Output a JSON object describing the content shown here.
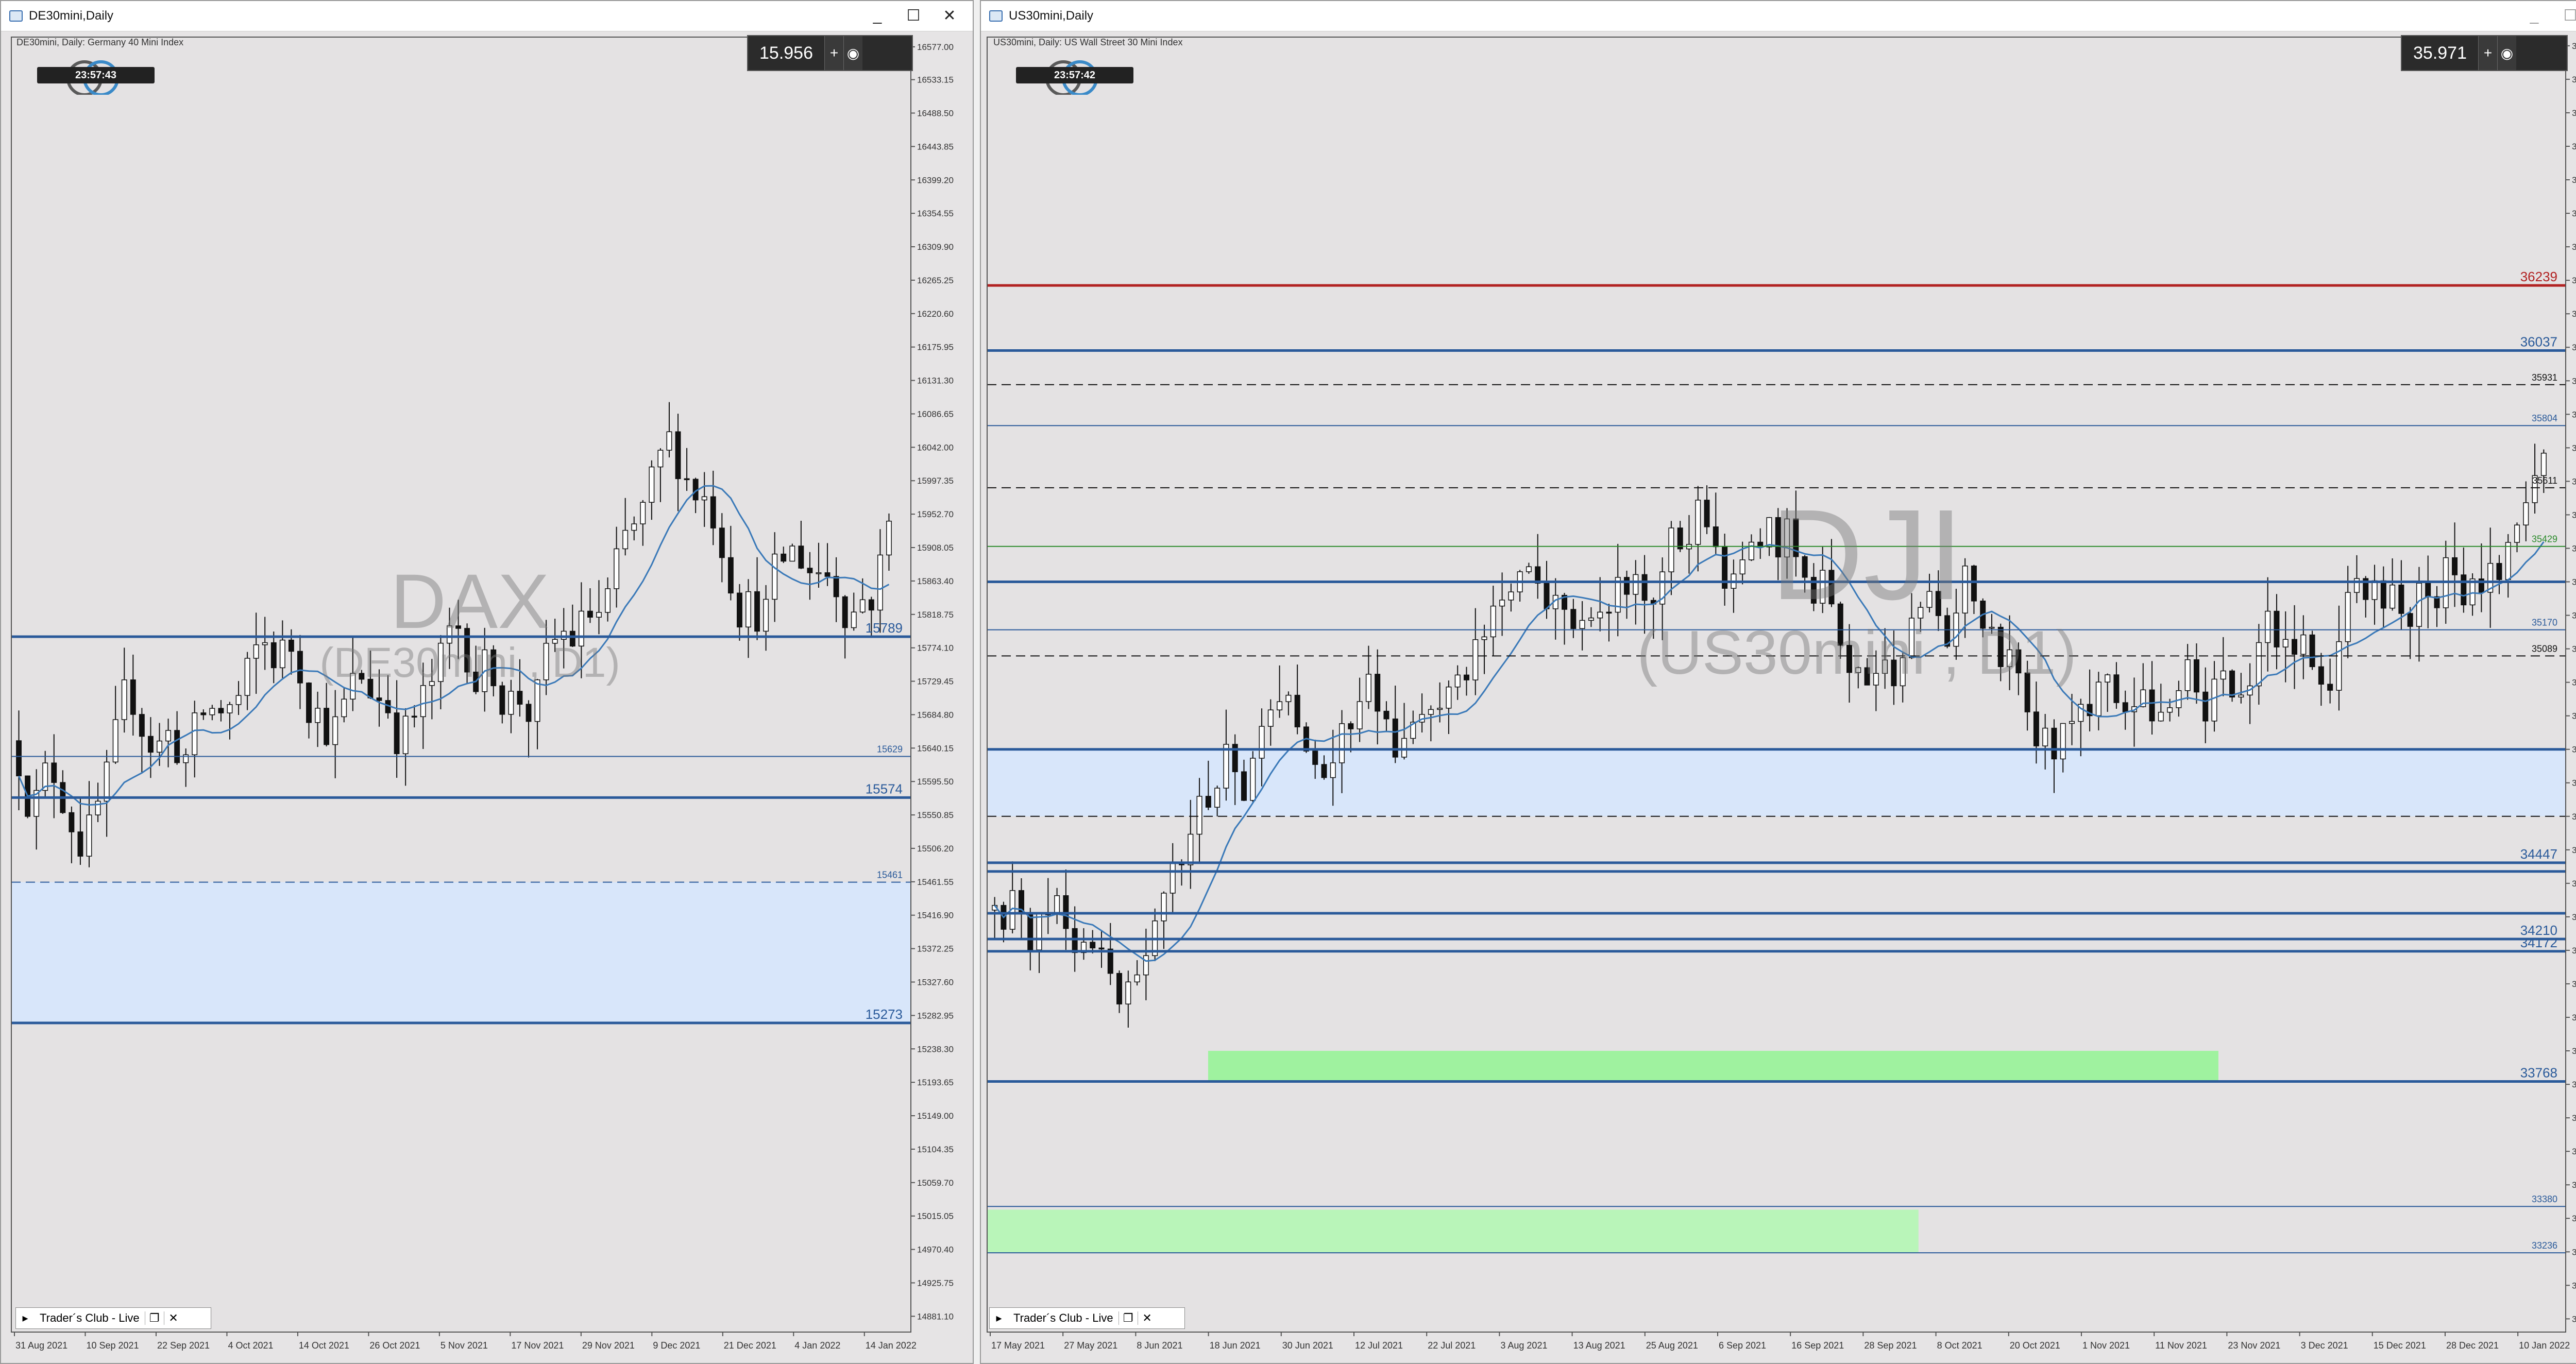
{
  "windows": [
    {
      "id": "dax",
      "title": "DE30mini,Daily",
      "info_line": "DE30mini, Daily:  Germany 40 Mini Index",
      "clock": "23:57:43",
      "price_display": "15.956",
      "watermark_main": "DAX",
      "watermark_sub": "(DE30mini , D1)",
      "tab_label": "Trader´s Club - Live",
      "window_controls": [
        "_",
        "☐",
        "✕"
      ],
      "price_scale": [
        "16577.00",
        "16533.15",
        "16488.50",
        "16443.85",
        "16399.20",
        "16354.55",
        "16309.90",
        "16265.25",
        "16220.60",
        "16175.95",
        "16131.30",
        "16086.65",
        "16042.00",
        "15997.35",
        "15952.70",
        "15908.05",
        "15863.40",
        "15818.75",
        "15774.10",
        "15729.45",
        "15684.80",
        "15640.15",
        "15595.50",
        "15550.85",
        "15506.20",
        "15461.55",
        "15416.90",
        "15372.25",
        "15327.60",
        "15282.95",
        "15238.30",
        "15193.65",
        "15149.00",
        "15104.35",
        "15059.70",
        "15015.05",
        "14970.40",
        "14925.75",
        "14881.10"
      ],
      "date_scale": [
        "31 Aug 2021",
        "10 Sep 2021",
        "22 Sep 2021",
        "4 Oct 2021",
        "14 Oct 2021",
        "26 Oct 2021",
        "5 Nov 2021",
        "17 Nov 2021",
        "29 Nov 2021",
        "9 Dec 2021",
        "21 Dec 2021",
        "4 Jan 2022",
        "14 Jan 2022"
      ],
      "levels": [
        {
          "value": 15789,
          "label": "15789",
          "color": "#2a5a9a",
          "style": "solid",
          "weight": "thick"
        },
        {
          "value": 15629,
          "label": "15629",
          "color": "#2a5a9a",
          "style": "solid",
          "weight": "thin"
        },
        {
          "value": 15574,
          "label": "15574",
          "color": "#2a5a9a",
          "style": "solid",
          "weight": "thick"
        },
        {
          "value": 15461,
          "label": "15461",
          "color": "#2a5a9a",
          "style": "dash",
          "weight": "thin"
        },
        {
          "value": 15273,
          "label": "15273",
          "color": "#2a5a9a",
          "style": "solid",
          "weight": "thick"
        }
      ],
      "zones": [
        {
          "from": 15273,
          "to": 15461,
          "color": "#d8e6fa"
        }
      ],
      "price_range": [
        14860,
        16590
      ],
      "candle_count": 100,
      "close_price": 15956,
      "series": [
        {
          "name": "",
          "color": "#3a79b8"
        }
      ]
    },
    {
      "id": "dji",
      "title": "US30mini,Daily",
      "info_line": "US30mini, Daily:  US Wall Street 30 Mini Index",
      "clock": "23:57:42",
      "price_display": "35.971",
      "watermark_main": "DJI",
      "watermark_sub": "(US30mini , D1)",
      "tab_label": "Trader´s Club - Live",
      "window_controls": [
        "_",
        "☐",
        "✕"
      ],
      "price_scale": [
        "36983.00",
        "36879.00",
        "36775.00",
        "36671.00",
        "36567.00",
        "36463.00",
        "36359.00",
        "36255.00",
        "36151.00",
        "36047.00",
        "35943.00",
        "35839.00",
        "35735.00",
        "35631.00",
        "35527.00",
        "35423.00",
        "35319.00",
        "35215.00",
        "35111.00",
        "35007.00",
        "34903.00",
        "34799.00",
        "34695.00",
        "34591.00",
        "34487.00",
        "34383.00",
        "34279.00",
        "34175.00",
        "34071.00",
        "33967.00",
        "33863.00",
        "33759.00",
        "33655.00",
        "33551.00",
        "33447.00",
        "33343.00",
        "33239.00",
        "33135.00",
        "33031.00"
      ],
      "date_scale": [
        "17 May 2021",
        "27 May 2021",
        "8 Jun 2021",
        "18 Jun 2021",
        "30 Jun 2021",
        "12 Jul 2021",
        "22 Jul 2021",
        "3 Aug 2021",
        "13 Aug 2021",
        "25 Aug 2021",
        "6 Sep 2021",
        "16 Sep 2021",
        "28 Sep 2021",
        "8 Oct 2021",
        "20 Oct 2021",
        "1 Nov 2021",
        "11 Nov 2021",
        "23 Nov 2021",
        "3 Dec 2021",
        "15 Dec 2021",
        "28 Dec 2021",
        "10 Jan 2022"
      ],
      "levels": [
        {
          "value": 36239,
          "label": "36239",
          "color": "#b22222",
          "style": "solid",
          "weight": "thick"
        },
        {
          "value": 36037,
          "label": "36037",
          "color": "#2a5a9a",
          "style": "solid",
          "weight": "thick"
        },
        {
          "value": 35931,
          "label": "35931",
          "color": "#111111",
          "style": "dash",
          "weight": "thin"
        },
        {
          "value": 35804,
          "label": "35804",
          "color": "#2a5a9a",
          "style": "solid",
          "weight": "thin"
        },
        {
          "value": 35611,
          "label": "35611",
          "color": "#111111",
          "style": "dash",
          "weight": "thin"
        },
        {
          "value": 35429,
          "label": "35429",
          "color": "#2a8a2a",
          "style": "solid",
          "weight": "thin"
        },
        {
          "value": 35319,
          "label": "",
          "color": "#2a5a9a",
          "style": "solid",
          "weight": "thick"
        },
        {
          "value": 35170,
          "label": "35170",
          "color": "#2a5a9a",
          "style": "solid",
          "weight": "thin"
        },
        {
          "value": 35089,
          "label": "35089",
          "color": "#111111",
          "style": "dash",
          "weight": "thin"
        },
        {
          "value": 34799,
          "label": "",
          "color": "#2a5a9a",
          "style": "solid",
          "weight": "thick"
        },
        {
          "value": 34591,
          "label": "",
          "color": "#111111",
          "style": "dash",
          "weight": "thin"
        },
        {
          "value": 34447,
          "label": "34447",
          "color": "#2a5a9a",
          "style": "solid",
          "weight": "thick"
        },
        {
          "value": 34420,
          "label": "",
          "color": "#2a5a9a",
          "style": "solid",
          "weight": "thick"
        },
        {
          "value": 34290,
          "label": "",
          "color": "#2a5a9a",
          "style": "solid",
          "weight": "thick"
        },
        {
          "value": 34210,
          "label": "34210",
          "color": "#2a5a9a",
          "style": "solid",
          "weight": "thick"
        },
        {
          "value": 34172,
          "label": "34172",
          "color": "#2a5a9a",
          "style": "solid",
          "weight": "thick"
        },
        {
          "value": 33768,
          "label": "33768",
          "color": "#2a5a9a",
          "style": "solid",
          "weight": "thick"
        },
        {
          "value": 33380,
          "label": "33380",
          "color": "#2a5a9a",
          "style": "solid",
          "weight": "thin"
        },
        {
          "value": 33236,
          "label": "33236",
          "color": "#2a5a9a",
          "style": "solid",
          "weight": "thin"
        }
      ],
      "zones": [
        {
          "from": 34591,
          "to": 34799,
          "color": "#d8e6fa"
        },
        {
          "from": 33768,
          "to": 33863,
          "color": "#9ff29f",
          "start_frac": 0.14,
          "end_frac": 0.78
        },
        {
          "from": 33236,
          "to": 33370,
          "color": "#b9f5b9",
          "start_frac": 0.0,
          "end_frac": 0.59
        }
      ],
      "price_range": [
        32990,
        37010
      ],
      "candle_count": 175,
      "close_price": 35971,
      "series": [
        {
          "name": "",
          "color": "#3a79b8"
        }
      ]
    }
  ]
}
